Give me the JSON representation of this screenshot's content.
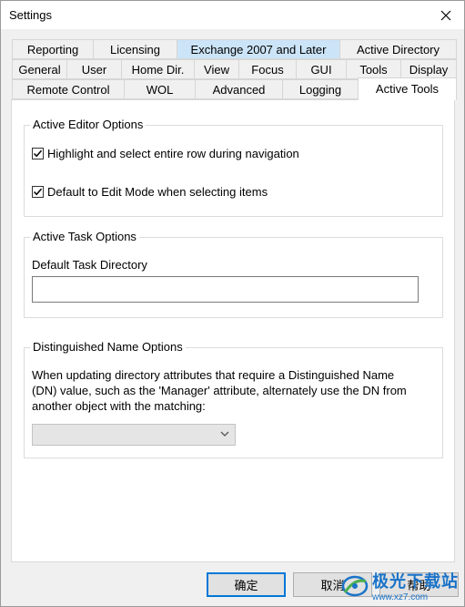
{
  "window": {
    "title": "Settings"
  },
  "tabs": {
    "row1": [
      "Reporting",
      "Licensing",
      "Exchange 2007 and Later",
      "Active Directory"
    ],
    "row2": [
      "General",
      "User",
      "Home Dir.",
      "View",
      "Focus",
      "GUI",
      "Tools",
      "Display"
    ],
    "row3": [
      "Remote Control",
      "WOL",
      "Advanced",
      "Logging",
      "Active Tools"
    ],
    "highlighted": "Exchange 2007 and Later",
    "active": "Active Tools"
  },
  "editor_group": {
    "title": "Active Editor Options",
    "opt1": {
      "label": "Highlight and select entire row during navigation",
      "checked": true
    },
    "opt2": {
      "label": "Default to Edit Mode when selecting items",
      "checked": true
    }
  },
  "task_group": {
    "title": "Active Task Options",
    "dir_label": "Default Task Directory",
    "dir_value": ""
  },
  "dn_group": {
    "title": "Distinguished Name Options",
    "line1": "When updating directory attributes that require a Distinguished Name",
    "line2": "(DN) value, such as the 'Manager' attribute, alternately use the DN from",
    "line3": "another object with the matching:",
    "select_value": ""
  },
  "buttons": {
    "ok": "确定",
    "cancel": "取消",
    "help": "帮助"
  },
  "watermark": {
    "name": "极光下载站",
    "url": "www.xz7.com"
  },
  "colors": {
    "tab_highlight": "#cce4f7",
    "default_button_border": "#0078d7",
    "watermark": "#1a73c8"
  }
}
